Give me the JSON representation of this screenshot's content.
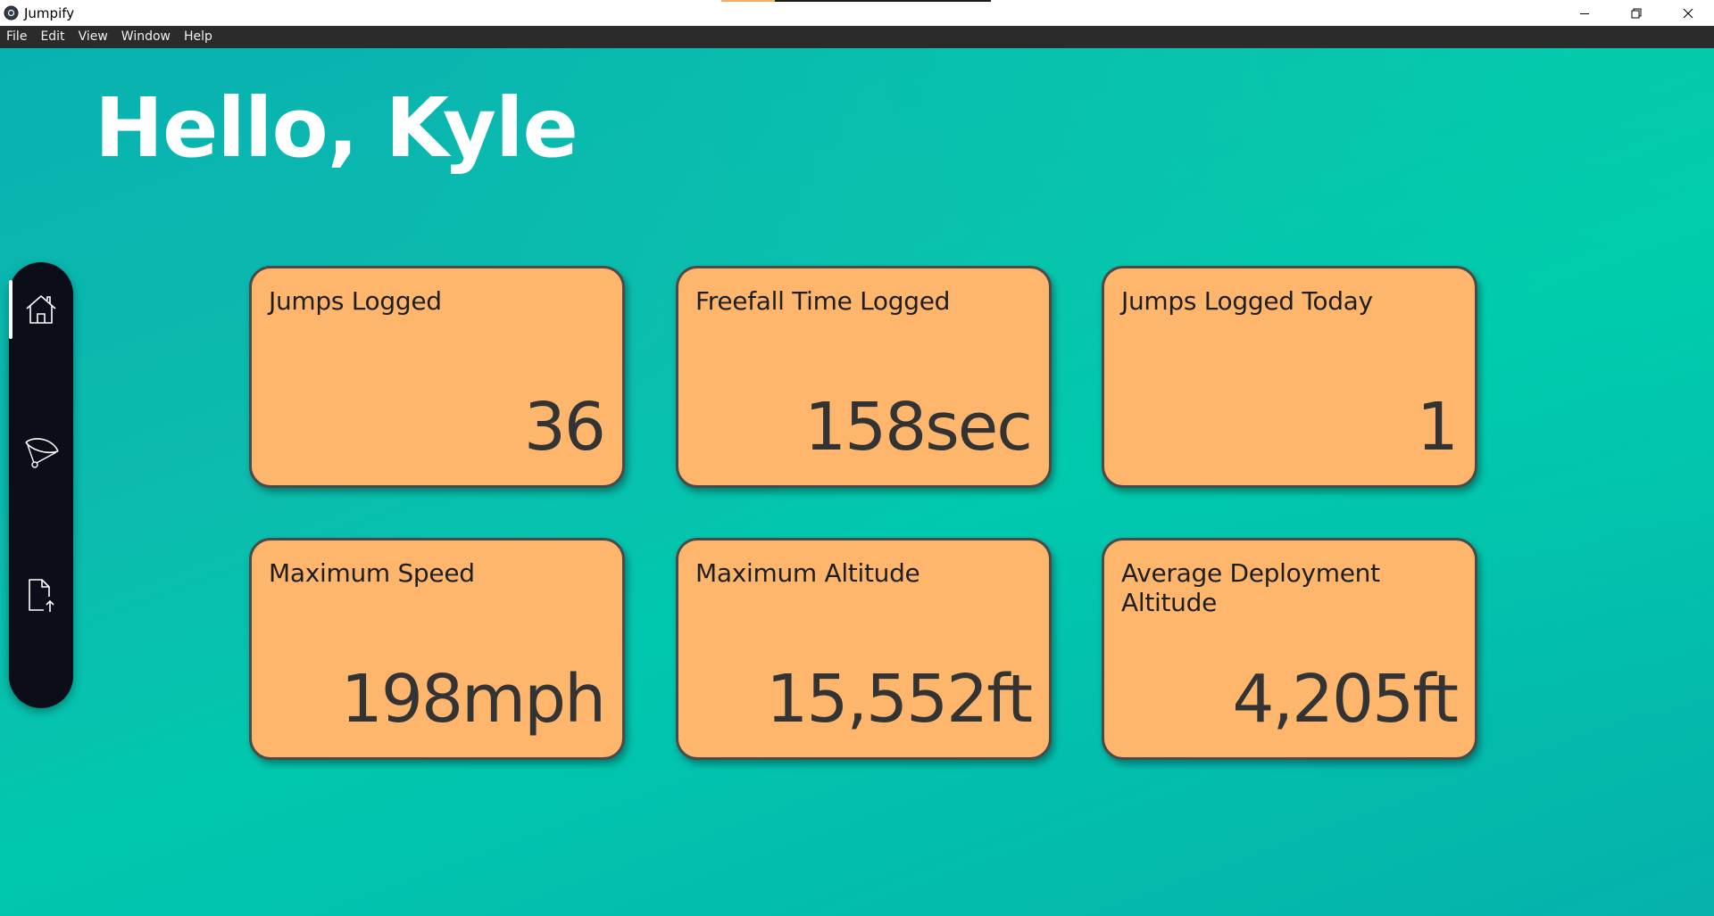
{
  "window": {
    "title": "Jumpify",
    "controls": [
      {
        "name": "minimize-button",
        "icon": "minimize-icon"
      },
      {
        "name": "restore-button",
        "icon": "restore-icon"
      },
      {
        "name": "close-button",
        "icon": "close-icon"
      }
    ]
  },
  "menu": {
    "file": "File",
    "edit": "Edit",
    "view": "View",
    "window": "Window",
    "help": "Help"
  },
  "greeting": "Hello, Kyle",
  "sidebar": {
    "items": [
      {
        "name": "home",
        "icon": "home-icon",
        "active": true
      },
      {
        "name": "jumps",
        "icon": "parachute-icon",
        "active": false
      },
      {
        "name": "upload",
        "icon": "file-upload-icon",
        "active": false
      }
    ]
  },
  "stats": {
    "jumps_logged": {
      "label": "Jumps Logged",
      "value": "36"
    },
    "freefall_time": {
      "label": "Freefall Time Logged",
      "value": "158sec"
    },
    "jumps_today": {
      "label": "Jumps Logged Today",
      "value": "1"
    },
    "max_speed": {
      "label": "Maximum Speed",
      "value": "198mph"
    },
    "max_altitude": {
      "label": "Maximum Altitude",
      "value": "15,552ft"
    },
    "avg_deployment": {
      "label": "Average Deployment Altitude",
      "value": "4,205ft"
    }
  },
  "colors": {
    "card_background": "#fdb66c",
    "card_border": "#4a4a4a",
    "sidebar_background": "#0b0d18",
    "background_teal": "#05b8b0",
    "menubar_background": "#2b2b2b"
  }
}
